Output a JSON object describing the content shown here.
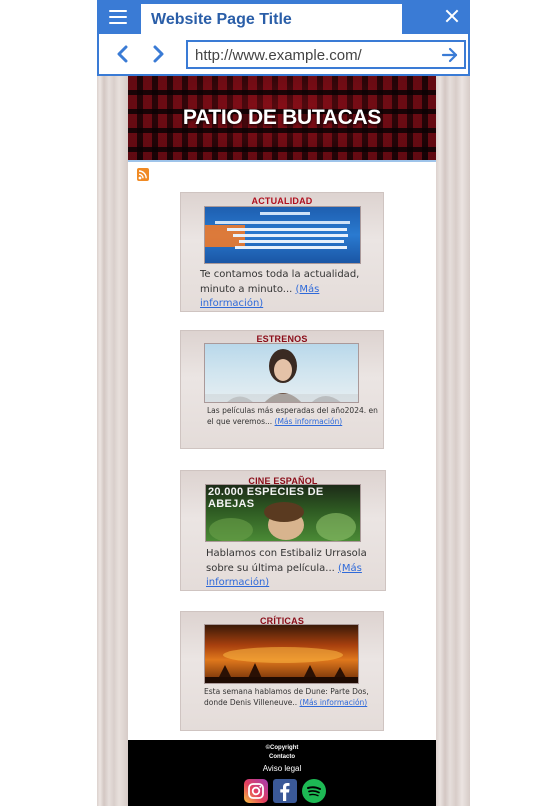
{
  "browser": {
    "tab_title": "Website Page Title",
    "url": "http://www.example.com/"
  },
  "site": {
    "banner_title": "PATIO DE BUTACAS",
    "cards": [
      {
        "title": "ACTUALIDAD",
        "text": "Te contamos toda la actualidad, minuto a minuto... ",
        "more": "(Más información)"
      },
      {
        "title": "ESTRENOS",
        "text": "Las películas más esperadas del año2024. en el que veremos... ",
        "more": "(Más información)"
      },
      {
        "title": "CINE ESPAÑOL",
        "thumb_caption": "20.000 ESPECIES DE ABEJAS",
        "text": "Hablamos con Estibaliz Urrasola sobre su última película... ",
        "more": "(Más información)"
      },
      {
        "title": "CRÍTICAS",
        "text": "Esta semana hablamos de Dune: Parte Dos, donde Denis Villeneuve.. ",
        "more": "(Más información)"
      }
    ],
    "footer": {
      "copyright": "©Copyright",
      "contact": "Contacto",
      "legal": "Aviso legal"
    }
  },
  "icons": [
    "menu-icon",
    "close-icon",
    "back-arrow-icon",
    "forward-arrow-icon",
    "go-arrow-icon",
    "rss-icon",
    "instagram-icon",
    "facebook-icon",
    "spotify-icon"
  ],
  "colors": {
    "chrome_blue": "#3a7bd5",
    "card_title_red": "#b0101e",
    "link_blue": "#2f6ad9",
    "footer_bg": "#000000"
  }
}
